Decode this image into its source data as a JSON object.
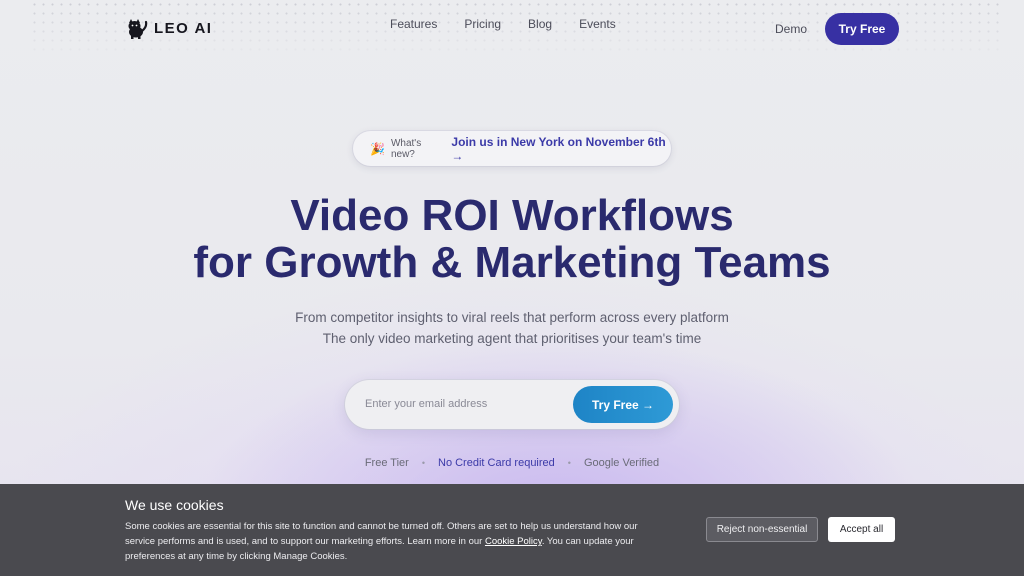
{
  "nav": {
    "brand": "LEO AI",
    "links": [
      "Features",
      "Pricing",
      "Blog",
      "Events"
    ],
    "demo_label": "Demo",
    "cta_label": "Try Free"
  },
  "announcement": {
    "emoji": "🎉",
    "small": "What's new?",
    "link": "Join us in New York on November 6th  →"
  },
  "hero": {
    "title_line1": "Video ROI Workflows",
    "title_line2": "for Growth & Marketing Teams",
    "sub_line1": "From competitor insights to viral reels that perform across every platform",
    "sub_line2": "The only video marketing agent that prioritises your team's time"
  },
  "form": {
    "email_placeholder": "Enter your email address",
    "email_value": "",
    "button_label": "Try Free  →"
  },
  "features": [
    "Free Tier",
    "No Credit Card required",
    "Google Verified"
  ],
  "feature_separator": "•",
  "cookie": {
    "title": "We use cookies",
    "text_before": "Some cookies are essential for this site to function and cannot be turned off. Others are set to help us understand how our service performs and is used, and to support our marketing efforts. Learn more in our ",
    "link": "Cookie Policy",
    "text_after": ". You can update your preferences at any time by clicking Manage Cookies.",
    "reject_label": "Reject non-essential",
    "accept_label": "Accept all"
  },
  "colors": {
    "brand_primary": "#3730a3",
    "cta_blue": "#1e84c6",
    "title": "#2a2a6e",
    "cookie_bg": "#4a4a4f"
  }
}
